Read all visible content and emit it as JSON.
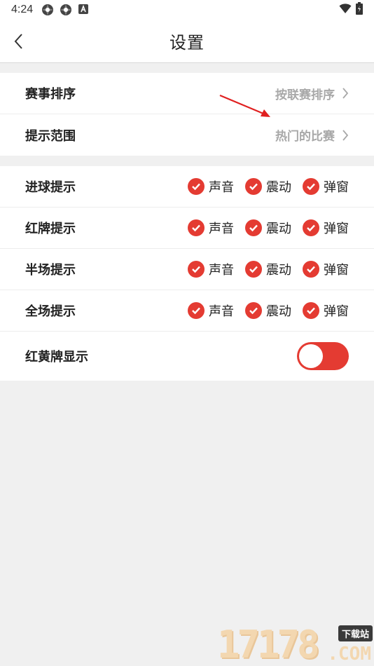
{
  "status_bar": {
    "time": "4:24",
    "icons": [
      "app-icon-1",
      "app-icon-2",
      "a-icon"
    ],
    "right_icons": [
      "wifi-icon",
      "battery-icon"
    ]
  },
  "header": {
    "title": "设置",
    "back_icon": "chevron-left-icon"
  },
  "section1": {
    "rows": [
      {
        "label": "赛事排序",
        "value": "按联赛排序"
      },
      {
        "label": "提示范围",
        "value": "热门的比赛"
      }
    ]
  },
  "section2": {
    "rows": [
      {
        "label": "进球提示",
        "options": [
          {
            "label": "声音",
            "checked": true
          },
          {
            "label": "震动",
            "checked": true
          },
          {
            "label": "弹窗",
            "checked": true
          }
        ]
      },
      {
        "label": "红牌提示",
        "options": [
          {
            "label": "声音",
            "checked": true
          },
          {
            "label": "震动",
            "checked": true
          },
          {
            "label": "弹窗",
            "checked": true
          }
        ]
      },
      {
        "label": "半场提示",
        "options": [
          {
            "label": "声音",
            "checked": true
          },
          {
            "label": "震动",
            "checked": true
          },
          {
            "label": "弹窗",
            "checked": true
          }
        ]
      },
      {
        "label": "全场提示",
        "options": [
          {
            "label": "声音",
            "checked": true
          },
          {
            "label": "震动",
            "checked": true
          },
          {
            "label": "弹窗",
            "checked": true
          }
        ]
      }
    ],
    "toggle_row": {
      "label": "红黄牌显示",
      "on": true
    }
  },
  "watermark": {
    "number": "17178",
    "tag": "下载站",
    "suffix": ".COM"
  },
  "colors": {
    "accent": "#e43b32",
    "page_bg": "#f0f0f0",
    "secondary_text": "#a8a8a8"
  }
}
